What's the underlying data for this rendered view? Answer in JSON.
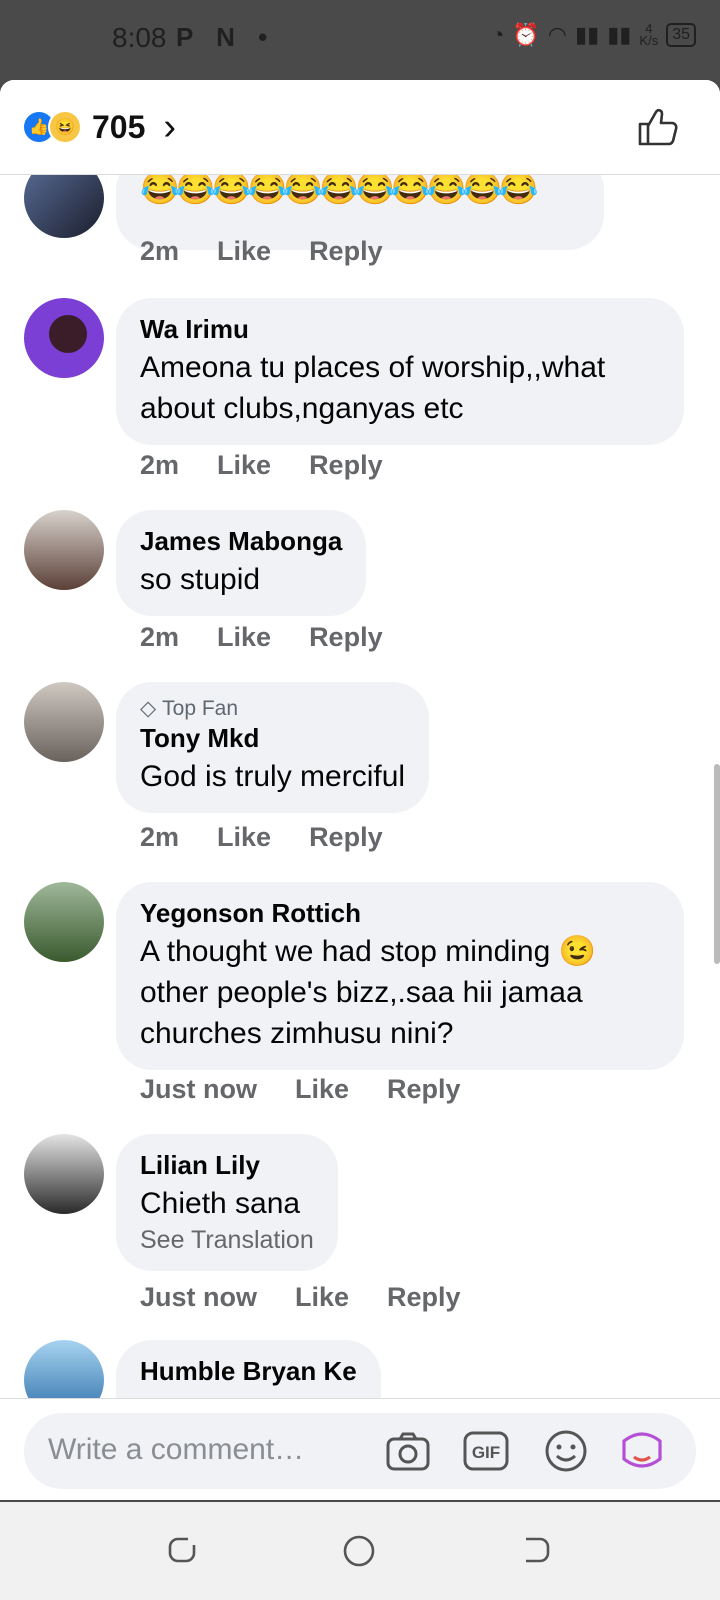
{
  "status_bar": {
    "time": "8:08",
    "left_icons": "P  N •",
    "network_speed_value": "4",
    "network_speed_unit": "K/s",
    "battery": "35"
  },
  "header": {
    "reaction_count": "705",
    "reaction_icons": [
      "like-icon",
      "haha-icon"
    ]
  },
  "comments": [
    {
      "author": "",
      "body": "😂😂😂😂😂😂😂😂😂😂😂",
      "time": "2m",
      "like": "Like",
      "reply": "Reply"
    },
    {
      "author": "Wa Irimu",
      "body": "Ameona tu places of worship,,what about clubs,nganyas etc",
      "time": "2m",
      "like": "Like",
      "reply": "Reply"
    },
    {
      "author": "James Mabonga",
      "body": "so stupid",
      "time": "2m",
      "like": "Like",
      "reply": "Reply"
    },
    {
      "badge": "Top Fan",
      "author": "Tony Mkd",
      "body": "God is truly merciful",
      "time": "2m",
      "like": "Like",
      "reply": "Reply"
    },
    {
      "author": "Yegonson Rottich",
      "body": "A thought we had stop minding 😉 other people's bizz,.saa hii jamaa churches zimhusu nini?",
      "time": "Just now",
      "like": "Like",
      "reply": "Reply"
    },
    {
      "author": "Lilian Lily",
      "body": "Chieth sana",
      "translation": "See Translation",
      "time": "Just now",
      "like": "Like",
      "reply": "Reply"
    },
    {
      "author": "Humble Bryan Ke",
      "body": ""
    }
  ],
  "composer": {
    "placeholder": "Write a comment…",
    "icons": [
      "camera-icon",
      "gif-icon",
      "emoji-icon",
      "avatar-sticker-icon"
    ]
  },
  "colors": {
    "accent": "#1877f2",
    "bubble": "#f0f2f5",
    "secondary_text": "#65676b",
    "sticker": "#b44fd6"
  }
}
